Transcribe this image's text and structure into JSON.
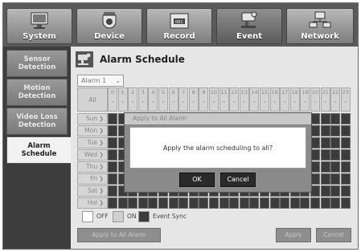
{
  "tabs": [
    {
      "label": "System",
      "icon": "monitor-icon"
    },
    {
      "label": "Device",
      "icon": "camera-icon"
    },
    {
      "label": "Record",
      "icon": "record-icon"
    },
    {
      "label": "Event",
      "icon": "event-camera-icon"
    },
    {
      "label": "Network",
      "icon": "network-icon"
    }
  ],
  "active_tab": "Event",
  "sidebar": {
    "items": [
      {
        "label": "Sensor Detection"
      },
      {
        "label": "Motion Detection"
      },
      {
        "label": "Video Loss Detection"
      },
      {
        "label": "Alarm Schedule"
      }
    ],
    "active": "Alarm Schedule"
  },
  "page": {
    "title": "Alarm Schedule",
    "alarm_select": {
      "value": "Alarm 1",
      "chevron": "⌄"
    }
  },
  "grid": {
    "all_label": "All",
    "hours": [
      "0",
      "1",
      "2",
      "3",
      "4",
      "5",
      "6",
      "7",
      "8",
      "9",
      "10",
      "11",
      "12",
      "13",
      "14",
      "15",
      "16",
      "17",
      "18",
      "19",
      "20",
      "21",
      "22",
      "23"
    ],
    "days": [
      "Sun",
      "Mon",
      "Tue",
      "Wed",
      "Thu",
      "Fri",
      "Sat",
      "Hol"
    ],
    "state": "Event Sync"
  },
  "dialog": {
    "title": "Apply to All Alarm",
    "message": "Apply the alarm scheduling to all?",
    "ok_label": "OK",
    "cancel_label": "Cancel"
  },
  "legend": {
    "off_label": "OFF",
    "on_label": "ON",
    "event_sync_label": "Event Sync",
    "colors": {
      "off": "#ffffff",
      "on": "#d0d0d0",
      "event_sync": "#3c3c3c"
    }
  },
  "footer": {
    "apply_all_label": "Apply to All Alarm",
    "apply_label": "Apply",
    "cancel_label": "Cancel"
  }
}
